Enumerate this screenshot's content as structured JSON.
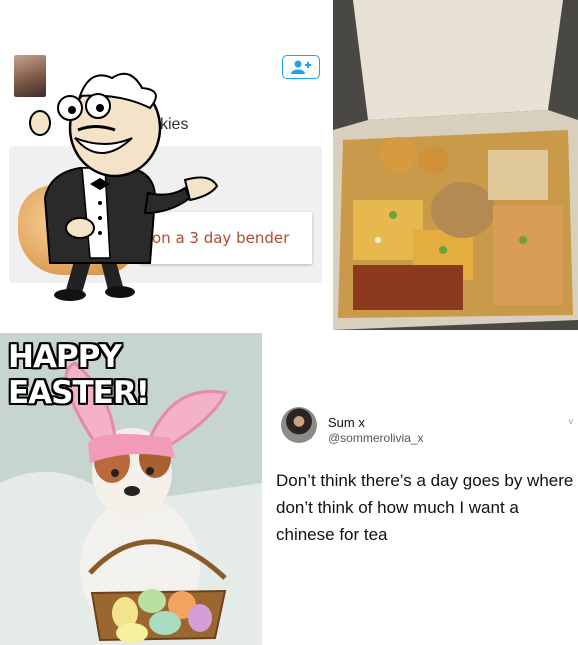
{
  "tweet_card": {
    "partial_word": "kies",
    "fortune_text": "on a 3 day bender",
    "follow_icon": "add-user-icon"
  },
  "food_photo": {
    "description_icon": "food-box-photo"
  },
  "easter_meme": {
    "title": "HAPPY EASTER!"
  },
  "tweet": {
    "display_name": "Sum x",
    "handle": "@sommerolivia_x",
    "text_lines": [
      "Don’t think there’s a day goes by where",
      "don’t think of how much I want a",
      "chinese for tea"
    ]
  },
  "colors": {
    "twitter_blue": "#1da1f2",
    "fortune_red": "#b04a2e"
  }
}
